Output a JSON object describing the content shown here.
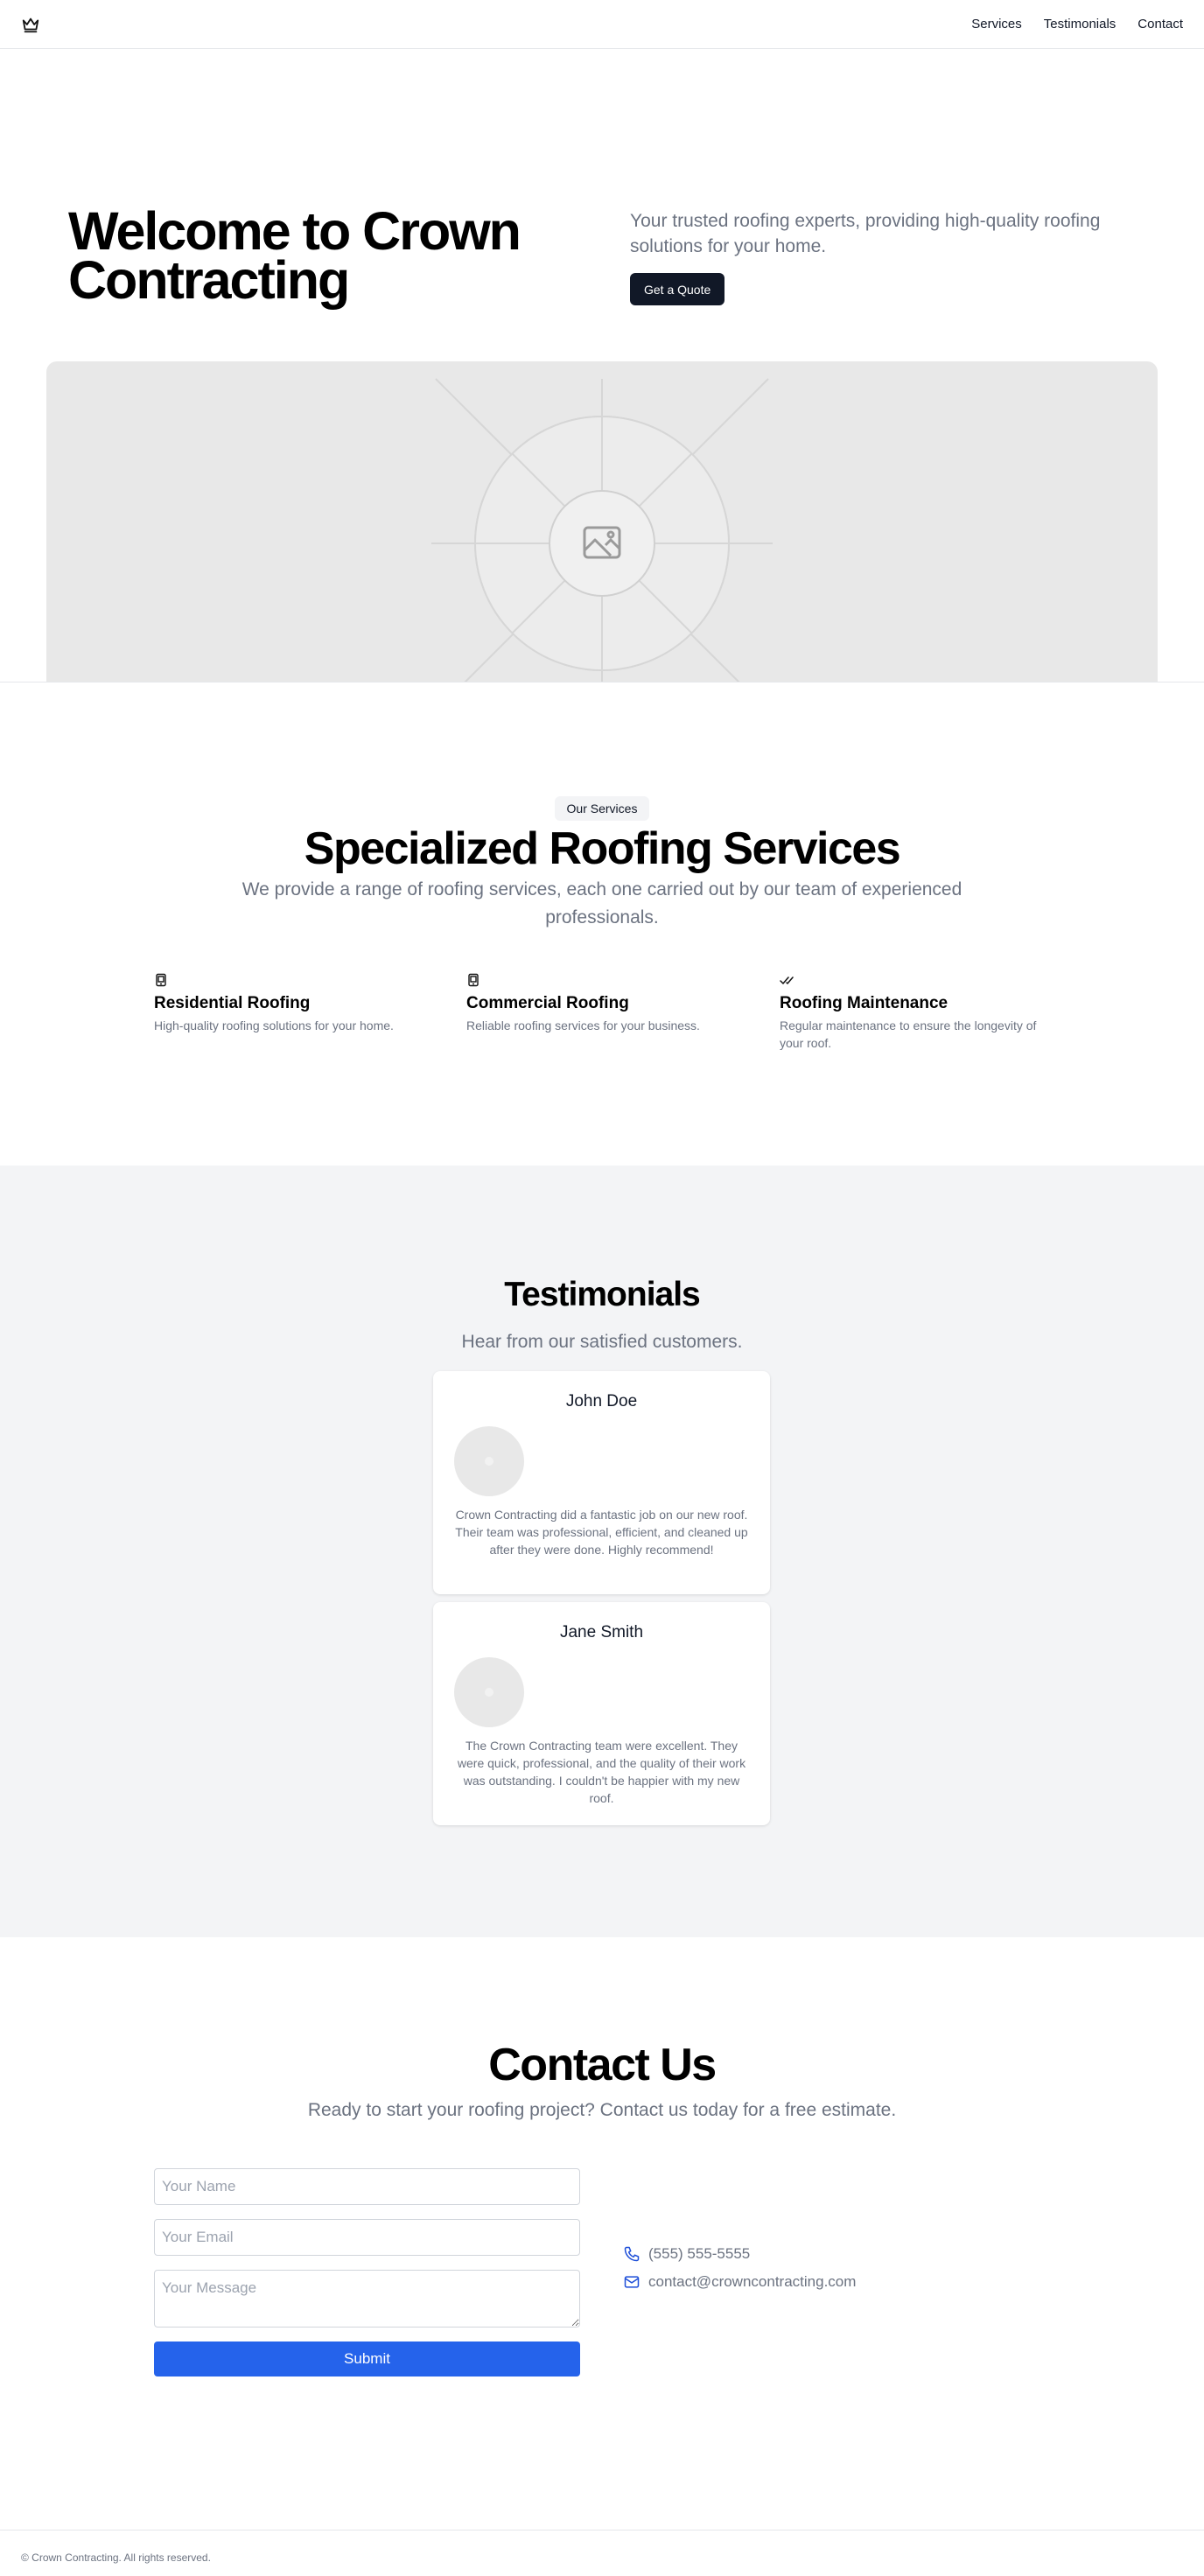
{
  "header": {
    "logo_icon": "crown-icon",
    "nav": [
      {
        "label": "Services"
      },
      {
        "label": "Testimonials"
      },
      {
        "label": "Contact"
      }
    ]
  },
  "hero": {
    "title": "Welcome to Crown Contracting",
    "subtitle": "Your trusted roofing experts, providing high-quality roofing solutions for your home.",
    "cta_label": "Get a Quote",
    "image_icon": "image-placeholder-icon"
  },
  "services": {
    "badge": "Our Services",
    "title": "Specialized Roofing Services",
    "subtitle": "We provide a range of roofing services, each one carried out by our team of experienced professionals.",
    "items": [
      {
        "icon": "tablet-icon",
        "title": "Residential Roofing",
        "description": "High-quality roofing solutions for your home."
      },
      {
        "icon": "tablet-icon",
        "title": "Commercial Roofing",
        "description": "Reliable roofing services for your business."
      },
      {
        "icon": "double-check-icon",
        "title": "Roofing Maintenance",
        "description": "Regular maintenance to ensure the longevity of your roof."
      }
    ]
  },
  "testimonials": {
    "title": "Testimonials",
    "subtitle": "Hear from our satisfied customers.",
    "items": [
      {
        "name": "John Doe",
        "text": "Crown Contracting did a fantastic job on our new roof. Their team was professional, efficient, and cleaned up after they were done. Highly recommend!"
      },
      {
        "name": "Jane Smith",
        "text": "The Crown Contracting team were excellent. They were quick, professional, and the quality of their work was outstanding. I couldn't be happier with my new roof."
      }
    ]
  },
  "contact": {
    "title": "Contact Us",
    "subtitle": "Ready to start your roofing project? Contact us today for a free estimate.",
    "name_placeholder": "Your Name",
    "email_placeholder": "Your Email",
    "message_placeholder": "Your Message",
    "submit_label": "Submit",
    "phone": "(555) 555-5555",
    "email": "contact@crowncontracting.com"
  },
  "footer": {
    "copyright": "© Crown Contracting. All rights reserved."
  },
  "colors": {
    "primary_dark": "#111827",
    "accent_blue": "#2563eb",
    "muted_text": "#6b7280",
    "section_gray": "#f3f4f6"
  }
}
